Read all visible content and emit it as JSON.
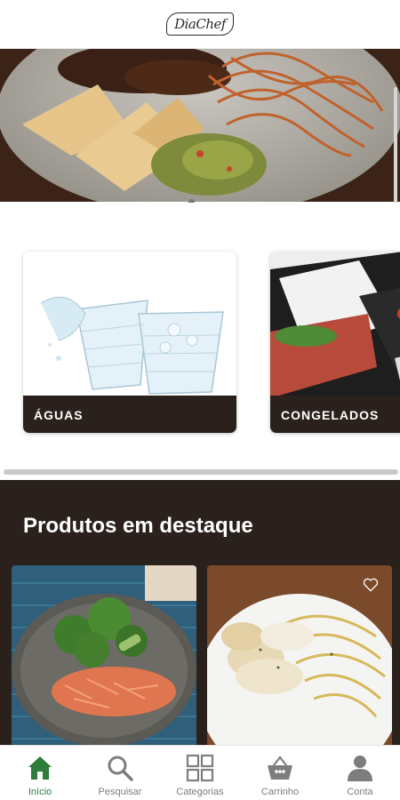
{
  "app": {
    "logo_text": "DiaChef"
  },
  "hero": {
    "image": "steak-spaghetti-nachos-guacamole-plate"
  },
  "categories": [
    {
      "label": "ÁGUAS",
      "image": "water-glasses"
    },
    {
      "label": "CONGELADOS",
      "image": "frozen-meal-trays"
    }
  ],
  "featured": {
    "title": "Produtos em destaque",
    "products": [
      {
        "image": "broccoli-shredded-chicken-plate"
      },
      {
        "image": "chicken-alfredo-spaghetti-plate",
        "favorite_icon": "heart-outline-icon"
      }
    ]
  },
  "bottom_nav": [
    {
      "label": "Início",
      "icon": "home-icon",
      "active": true
    },
    {
      "label": "Pesquisar",
      "icon": "search-icon",
      "active": false
    },
    {
      "label": "Categorias",
      "icon": "grid-icon",
      "active": false
    },
    {
      "label": "Carrinho",
      "icon": "basket-icon",
      "active": false
    },
    {
      "label": "Conta",
      "icon": "user-icon",
      "active": false
    }
  ],
  "colors": {
    "accent": "#2e7d3a",
    "dark": "#2a211d",
    "inactive": "#7d7d7d"
  }
}
